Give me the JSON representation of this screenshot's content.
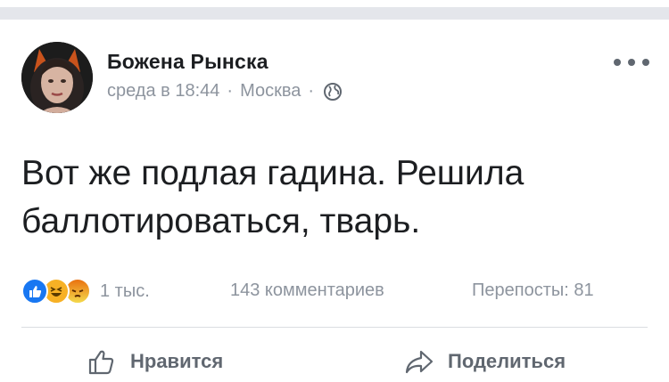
{
  "post": {
    "author": "Божена Рынска",
    "time": "среда в 18:44",
    "separator": "·",
    "location": "Москва",
    "text": "Вот же подлая гадина. Решила баллотироваться, тварь."
  },
  "stats": {
    "reactions_count": "1 тыс.",
    "comments": "143 комментариев",
    "shares": "Перепосты: 81"
  },
  "actions": {
    "like": "Нравится",
    "share": "Поделиться"
  },
  "icons": {
    "privacy": "globe-icon",
    "menu": "more-options-icon",
    "reactions": [
      "like-reaction-icon",
      "haha-reaction-icon",
      "angry-reaction-icon"
    ],
    "like_action": "thumbs-up-icon",
    "share_action": "share-arrow-icon"
  },
  "colors": {
    "meta_text": "#8d949e",
    "main_text": "#1c1e21",
    "action_text": "#606770",
    "like_blue": "#1877f2"
  }
}
